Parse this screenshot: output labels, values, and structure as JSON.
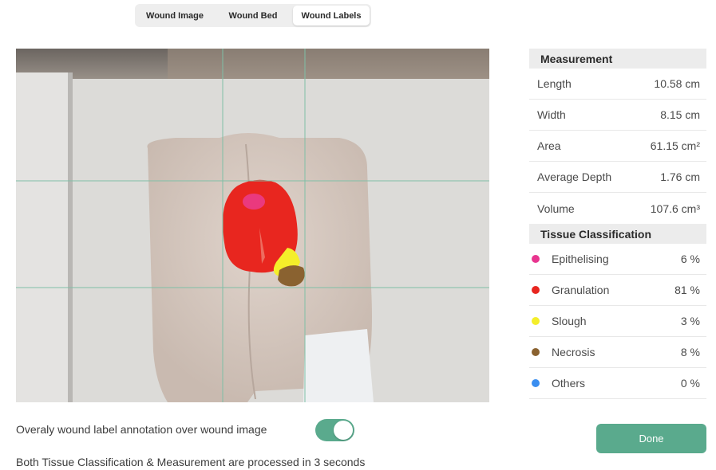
{
  "tabs": [
    {
      "label": "Wound Image",
      "active": false
    },
    {
      "label": "Wound Bed",
      "active": false
    },
    {
      "label": "Wound Labels",
      "active": true
    }
  ],
  "measurement": {
    "header": "Measurement",
    "rows": [
      {
        "label": "Length",
        "value": "10.58 cm"
      },
      {
        "label": "Width",
        "value": "8.15 cm"
      },
      {
        "label": "Area",
        "value": "61.15 cm²"
      },
      {
        "label": "Average Depth",
        "value": "1.76 cm"
      },
      {
        "label": "Volume",
        "value": "107.6 cm³"
      }
    ]
  },
  "tissue": {
    "header": "Tissue Classification",
    "rows": [
      {
        "label": "Epithelising",
        "value": "6 %",
        "color": "#e8358f"
      },
      {
        "label": "Granulation",
        "value": "81 %",
        "color": "#e8261f"
      },
      {
        "label": "Slough",
        "value": "3 %",
        "color": "#f4ee2a"
      },
      {
        "label": "Necrosis",
        "value": "8 %",
        "color": "#8a6230"
      },
      {
        "label": "Others",
        "value": "0 %",
        "color": "#3a8ef0"
      }
    ]
  },
  "overlay": {
    "label": "Overaly wound label annotation over wound image",
    "enabled": true
  },
  "status_text": "Both Tissue Classification & Measurement are processed in 3 seconds",
  "done_label": "Done",
  "colors": {
    "accent": "#5aaa8d"
  }
}
